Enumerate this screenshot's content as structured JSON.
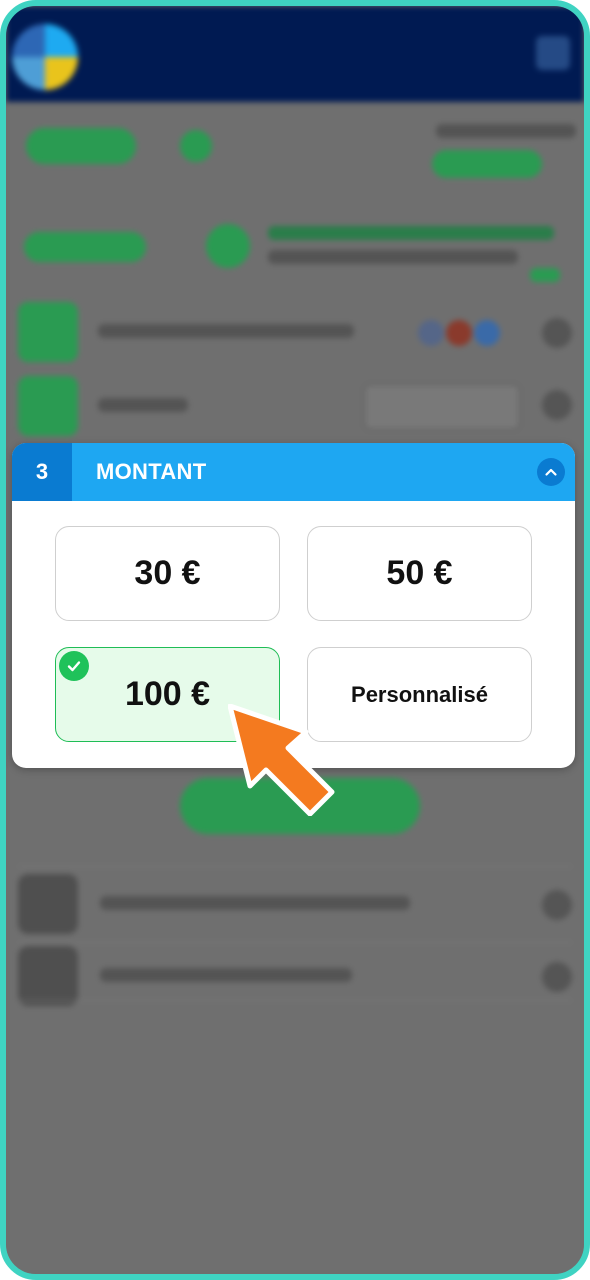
{
  "step": {
    "number": "3",
    "title": "MONTANT"
  },
  "amount_options": [
    {
      "label": "30 €",
      "selected": false
    },
    {
      "label": "50 €",
      "selected": false
    },
    {
      "label": "100 €",
      "selected": true
    },
    {
      "label": "Personnalisé",
      "selected": false
    }
  ],
  "icons": {
    "collapse": "chevron-up-icon",
    "selected_check": "check-icon",
    "pointer": "cursor-arrow-icon",
    "logo": "logo-icon",
    "menu": "menu-icon"
  },
  "colors": {
    "frame": "#3fd3c2",
    "header_bar": "#1ea7f2",
    "step_box": "#0a7bd1",
    "selected_fill": "#e6fbea",
    "selected_border": "#1fbd56",
    "pointer": "#f47a1f",
    "top_bar": "#001a52"
  }
}
